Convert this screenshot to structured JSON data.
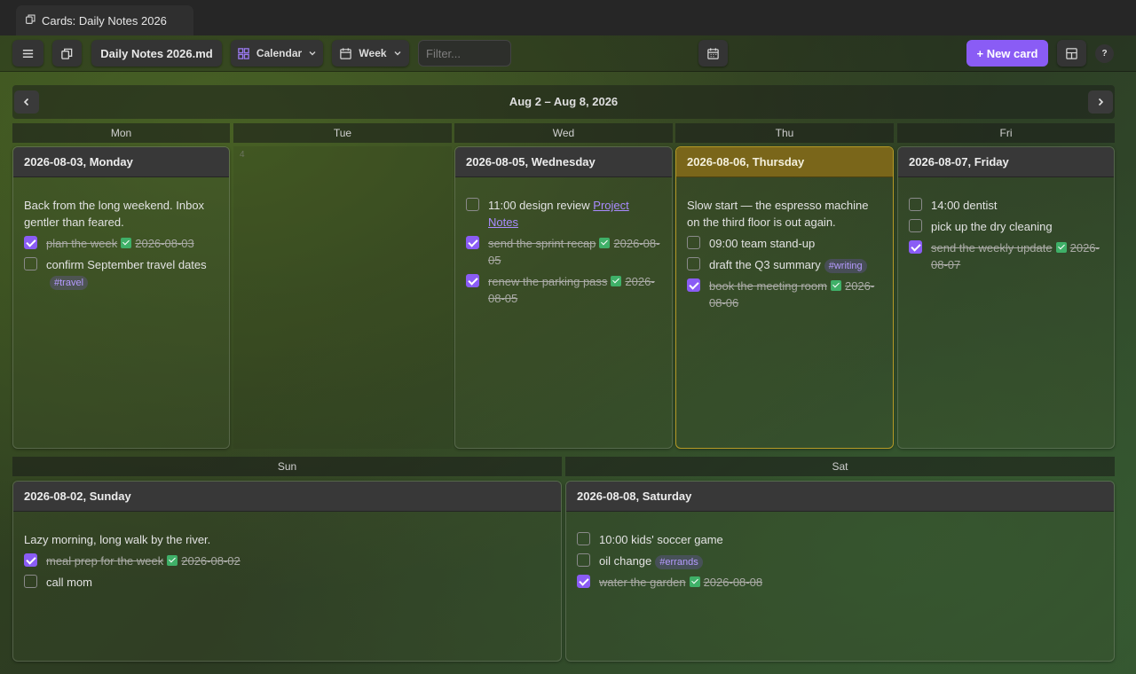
{
  "tab": {
    "title": "Cards: Daily Notes 2026"
  },
  "toolbar": {
    "file_name": "Daily Notes 2026.md",
    "view_select": "Calendar",
    "range_select": "Week",
    "filter_placeholder": "Filter...",
    "new_card_label": "+ New card",
    "help_label": "?"
  },
  "week": {
    "title": "Aug 2 – Aug 8, 2026",
    "day_headers": [
      "Mon",
      "Tue",
      "Wed",
      "Thu",
      "Fri",
      "Sun",
      "Sat"
    ],
    "empty_day_number": "4"
  },
  "cards": [
    {
      "title": "2026-08-03, Monday",
      "note": "Back from the long weekend. Inbox gentler than feared.",
      "tasks": [
        {
          "text": "plan the week",
          "done": true,
          "date": "2026-08-03"
        },
        {
          "text": "confirm September travel dates",
          "done": false,
          "tag": "#travel"
        }
      ]
    },
    {
      "title": "2026-08-05, Wednesday",
      "tasks": [
        {
          "text": "11:00 design review",
          "done": false,
          "link": "Project Notes"
        },
        {
          "text": "send the sprint recap",
          "done": true,
          "date": "2026-08-05"
        },
        {
          "text": "renew the parking pass",
          "done": true,
          "date": "2026-08-05"
        }
      ]
    },
    {
      "title": "2026-08-06, Thursday",
      "note": "Slow start — the espresso machine on the third floor is out again.",
      "tasks": [
        {
          "text": "09:00 team stand-up",
          "done": false
        },
        {
          "text": "draft the Q3 summary",
          "done": false,
          "tag": "#writing"
        },
        {
          "text": "book the meeting room",
          "done": true,
          "date": "2026-08-06"
        }
      ]
    },
    {
      "title": "2026-08-07, Friday",
      "tasks": [
        {
          "text": "14:00 dentist",
          "done": false
        },
        {
          "text": "pick up the dry cleaning",
          "done": false
        },
        {
          "text": "send the weekly update",
          "done": true,
          "date": "2026-08-07"
        }
      ]
    },
    {
      "title": "2026-08-02, Sunday",
      "note": "Lazy morning, long walk by the river.",
      "tasks": [
        {
          "text": "meal prep for the week",
          "done": true,
          "date": "2026-08-02"
        },
        {
          "text": "call mom",
          "done": false
        }
      ]
    },
    {
      "title": "2026-08-08, Saturday",
      "tasks": [
        {
          "text": "10:00 kids' soccer game",
          "done": false
        },
        {
          "text": "oil change",
          "done": false,
          "tag": "#errands"
        },
        {
          "text": "water the garden",
          "done": true,
          "date": "2026-08-08"
        }
      ]
    }
  ],
  "colors": {
    "accent": "#8a5cf5",
    "today_header": "#7a661a",
    "done_check": "#3fb068"
  }
}
